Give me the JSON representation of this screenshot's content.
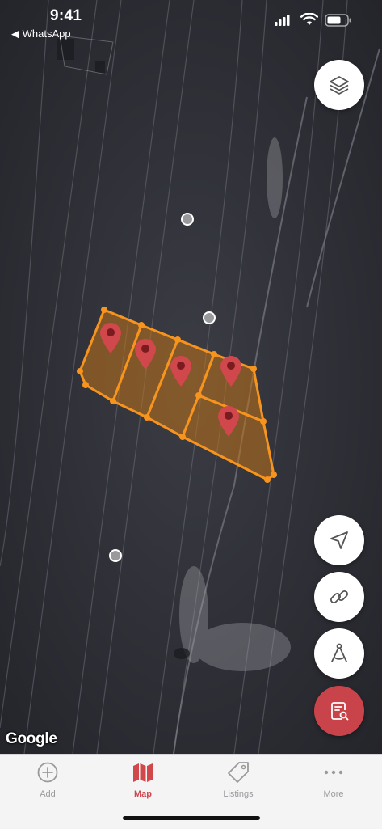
{
  "status_bar": {
    "time": "9:41",
    "back_app": "◀ WhatsApp"
  },
  "map": {
    "attribution": "Google",
    "parcel_color": "#f7941d",
    "pin_color": "#d0474c"
  },
  "map_controls": {
    "layers_icon": "layers-icon",
    "locate_icon": "navigation-arrow-icon",
    "link_icon": "link-icon",
    "measure_icon": "compass-icon",
    "report_icon": "document-search-icon",
    "accent_color": "#c9444a"
  },
  "tabbar": {
    "tabs": [
      {
        "label": "Add",
        "icon": "plus-circle-icon"
      },
      {
        "label": "Map",
        "icon": "map-icon"
      },
      {
        "label": "Listings",
        "icon": "tag-icon"
      },
      {
        "label": "More",
        "icon": "ellipsis-icon"
      }
    ],
    "active": "Map",
    "active_color": "#d0474c",
    "inactive_color": "#9a9a9e"
  }
}
